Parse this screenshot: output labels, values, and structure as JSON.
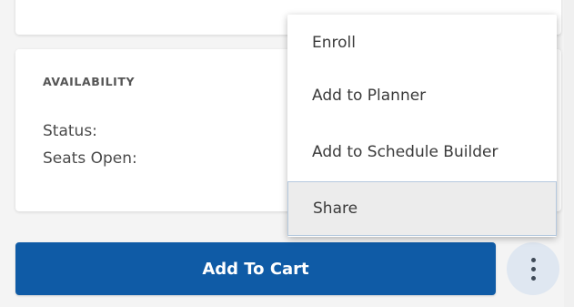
{
  "availability": {
    "heading": "AVAILABILITY",
    "status_label": "Status:",
    "seats_open_label": "Seats Open:"
  },
  "actions": {
    "add_to_cart_label": "Add To Cart",
    "more_icon": "kebab-vertical-icon"
  },
  "menu": {
    "items": [
      {
        "label": "Enroll"
      },
      {
        "label": "Add to Planner"
      },
      {
        "label": "Add to Schedule Builder"
      },
      {
        "label": "Share",
        "hovered": true
      }
    ]
  },
  "colors": {
    "primary_button": "#0f5ba6",
    "more_button_bg": "#dfe7f1",
    "menu_hover_bg": "#ececec"
  }
}
